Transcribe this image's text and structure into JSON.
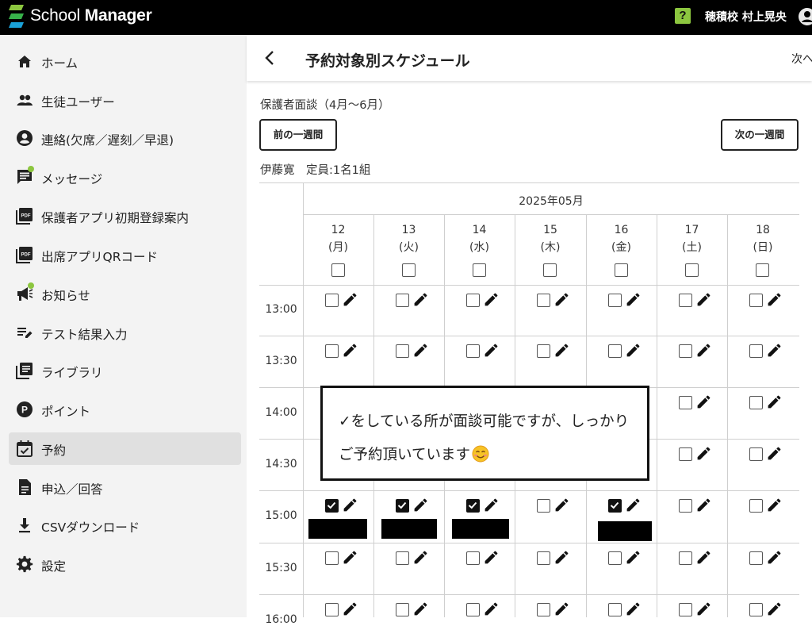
{
  "app": {
    "name_regular": "School ",
    "name_bold": "Manager",
    "user_name": "穂積校 村上晃央",
    "help_label": "?"
  },
  "sidebar": {
    "items": [
      {
        "label": "ホーム",
        "icon": "home-icon"
      },
      {
        "label": "生徒ユーザー",
        "icon": "people-icon"
      },
      {
        "label": "連絡(欠席／遅刻／早退)",
        "icon": "account-circle-icon"
      },
      {
        "label": "メッセージ",
        "icon": "message-icon",
        "badge": true
      },
      {
        "label": "保護者アプリ初期登録案内",
        "icon": "pdf-icon"
      },
      {
        "label": "出席アプリQRコード",
        "icon": "pdf-icon"
      },
      {
        "label": "お知らせ",
        "icon": "megaphone-icon",
        "badge": true
      },
      {
        "label": "テスト結果入力",
        "icon": "edit-list-icon"
      },
      {
        "label": "ライブラリ",
        "icon": "library-icon"
      },
      {
        "label": "ポイント",
        "icon": "point-icon"
      },
      {
        "label": "予約",
        "icon": "calendar-check-icon",
        "active": true
      },
      {
        "label": "申込／回答",
        "icon": "document-icon"
      },
      {
        "label": "CSVダウンロード",
        "icon": "download-icon"
      },
      {
        "label": "設定",
        "icon": "gear-icon"
      }
    ]
  },
  "header": {
    "title": "予約対象別スケジュール",
    "next_link": "次へ"
  },
  "schedule": {
    "section_title": "保護者面談（4月〜6月）",
    "prev_week": "前の一週間",
    "next_week": "次の一週間",
    "teacher_capacity": "伊藤寛　定員:1名1組",
    "month": "2025年05月",
    "days": [
      {
        "date": "12",
        "weekday": "(月)"
      },
      {
        "date": "13",
        "weekday": "(火)"
      },
      {
        "date": "14",
        "weekday": "(水)"
      },
      {
        "date": "15",
        "weekday": "(木)"
      },
      {
        "date": "16",
        "weekday": "(金)"
      },
      {
        "date": "17",
        "weekday": "(土)"
      },
      {
        "date": "18",
        "weekday": "(日)"
      }
    ],
    "times": [
      "13:00",
      "13:30",
      "14:00",
      "14:30",
      "15:00",
      "15:30",
      "16:00"
    ],
    "checked_slots": [
      {
        "time": "15:00",
        "day": "12"
      },
      {
        "time": "15:00",
        "day": "13"
      },
      {
        "time": "15:00",
        "day": "14"
      },
      {
        "time": "15:00",
        "day": "16"
      }
    ]
  },
  "annotation": {
    "line1": "✓をしている所が面談可能ですが、しっかり",
    "line2": "ご予約頂いています"
  },
  "colors": {
    "topbar": "#000000",
    "sidebar_bg": "#f3f3f3",
    "active_item": "#e0e0e0",
    "accent_green": "#8cc63f"
  }
}
